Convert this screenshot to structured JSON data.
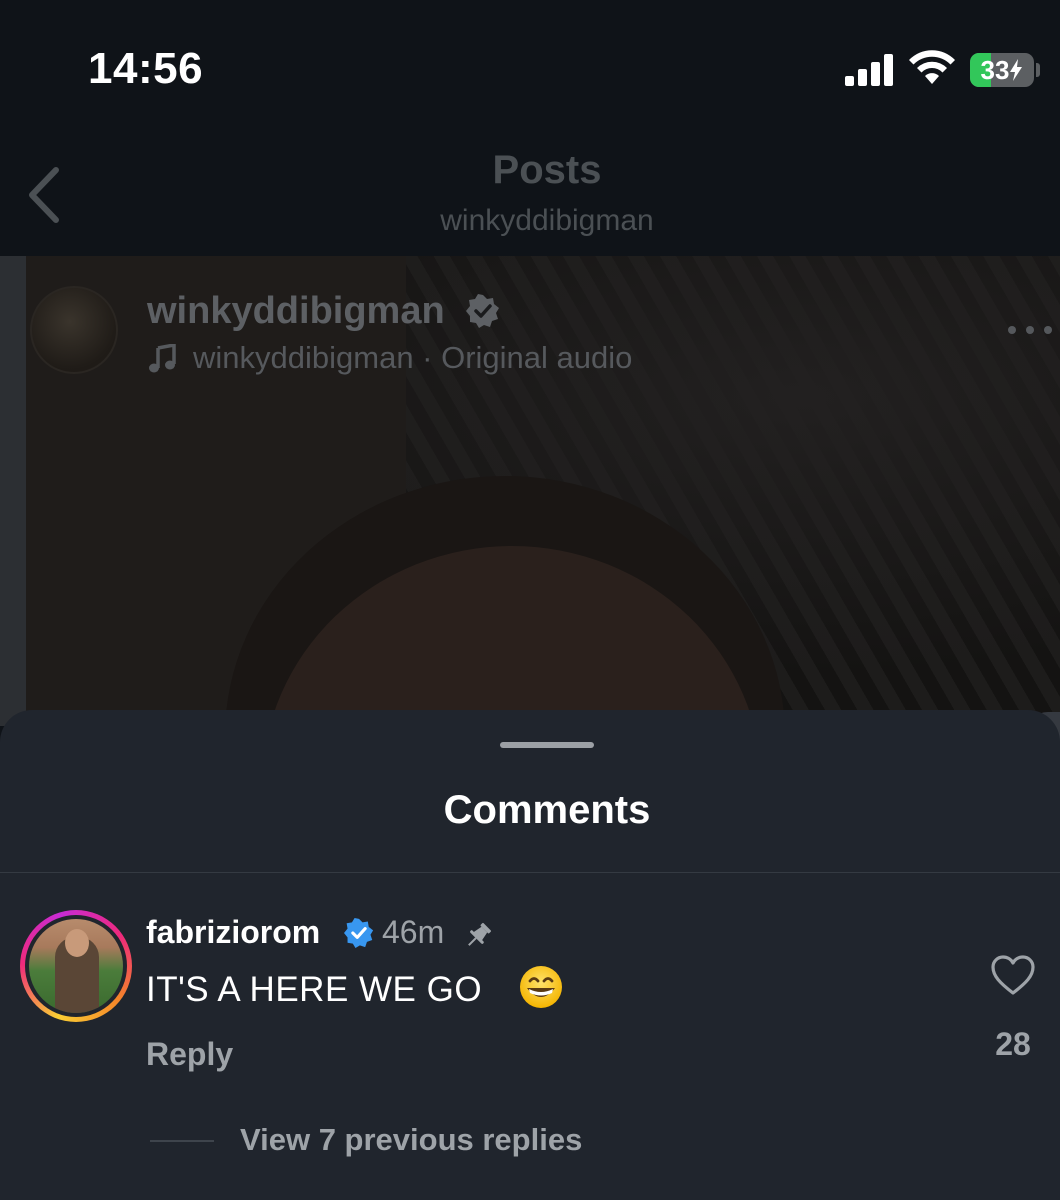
{
  "status_bar": {
    "time": "14:56",
    "battery_level": "33",
    "battery_fraction": 0.33,
    "battery_charging": true,
    "icons": [
      "cellular-signal-icon",
      "wifi-icon",
      "battery-charging-icon"
    ]
  },
  "header": {
    "title": "Posts",
    "subtitle": "winkyddibigman",
    "back_icon": "chevron-left-icon"
  },
  "post": {
    "username": "winkyddibigman",
    "verified": true,
    "audio_label": "winkyddibigman · Original audio",
    "more_icon": "ellipsis-icon"
  },
  "comments_sheet": {
    "title": "Comments",
    "comments": [
      {
        "username": "fabriziorom",
        "verified": true,
        "time": "46m",
        "pinned": true,
        "text": "IT'S A HERE WE GO",
        "emoji": "grinning-face-with-smiling-eyes",
        "reply_label": "Reply",
        "like_count": "28",
        "view_replies_label": "View 7 previous replies"
      }
    ]
  },
  "colors": {
    "background": "#0f1318",
    "sheet": "#20252d",
    "verified_blue": "#3897f0",
    "muted_text": "#9ea3a8",
    "battery_green": "#32c75a"
  }
}
